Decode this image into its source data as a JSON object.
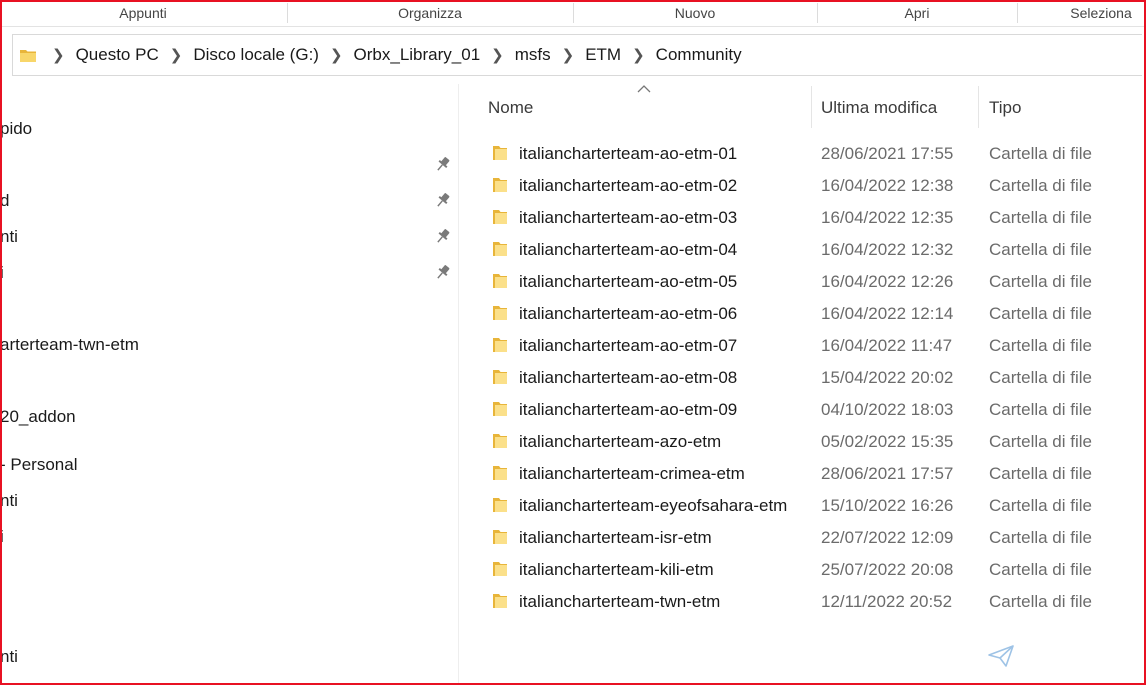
{
  "ribbon": {
    "groups": [
      "Appunti",
      "Organizza",
      "Nuovo",
      "Apri",
      "Seleziona"
    ]
  },
  "address_bar": {
    "icon": "folder-icon",
    "crumbs": [
      "Questo PC",
      "Disco locale (G:)",
      "Orbx_Library_01",
      "msfs",
      "ETM",
      "Community"
    ]
  },
  "nav_pane": {
    "items": [
      "pido",
      "d",
      "nti",
      "i",
      "arterteam-twn-etm",
      "20_addon",
      "- Personal",
      "nti",
      "i",
      "nti"
    ],
    "pin_icon": "pin-icon"
  },
  "file_list": {
    "columns": {
      "name": "Nome",
      "modified": "Ultima modifica",
      "type": "Tipo"
    },
    "rows": [
      {
        "name": "italiancharterteam-ao-etm-01",
        "modified": "28/06/2021 17:55",
        "type": "Cartella di file"
      },
      {
        "name": "italiancharterteam-ao-etm-02",
        "modified": "16/04/2022 12:38",
        "type": "Cartella di file"
      },
      {
        "name": "italiancharterteam-ao-etm-03",
        "modified": "16/04/2022 12:35",
        "type": "Cartella di file"
      },
      {
        "name": "italiancharterteam-ao-etm-04",
        "modified": "16/04/2022 12:32",
        "type": "Cartella di file"
      },
      {
        "name": "italiancharterteam-ao-etm-05",
        "modified": "16/04/2022 12:26",
        "type": "Cartella di file"
      },
      {
        "name": "italiancharterteam-ao-etm-06",
        "modified": "16/04/2022 12:14",
        "type": "Cartella di file"
      },
      {
        "name": "italiancharterteam-ao-etm-07",
        "modified": "16/04/2022 11:47",
        "type": "Cartella di file"
      },
      {
        "name": "italiancharterteam-ao-etm-08",
        "modified": "15/04/2022 20:02",
        "type": "Cartella di file"
      },
      {
        "name": "italiancharterteam-ao-etm-09",
        "modified": "04/10/2022 18:03",
        "type": "Cartella di file"
      },
      {
        "name": "italiancharterteam-azo-etm",
        "modified": "05/02/2022 15:35",
        "type": "Cartella di file"
      },
      {
        "name": "italiancharterteam-crimea-etm",
        "modified": "28/06/2021 17:57",
        "type": "Cartella di file"
      },
      {
        "name": "italiancharterteam-eyeofsahara-etm",
        "modified": "15/10/2022 16:26",
        "type": "Cartella di file"
      },
      {
        "name": "italiancharterteam-isr-etm",
        "modified": "22/07/2022 12:09",
        "type": "Cartella di file"
      },
      {
        "name": "italiancharterteam-kili-etm",
        "modified": "25/07/2022 20:08",
        "type": "Cartella di file"
      },
      {
        "name": "italiancharterteam-twn-etm",
        "modified": "12/11/2022 20:52",
        "type": "Cartella di file"
      }
    ]
  },
  "colors": {
    "frame": "#e81123",
    "folder": "#f4c542",
    "send_icon": "#9ec3e6"
  }
}
